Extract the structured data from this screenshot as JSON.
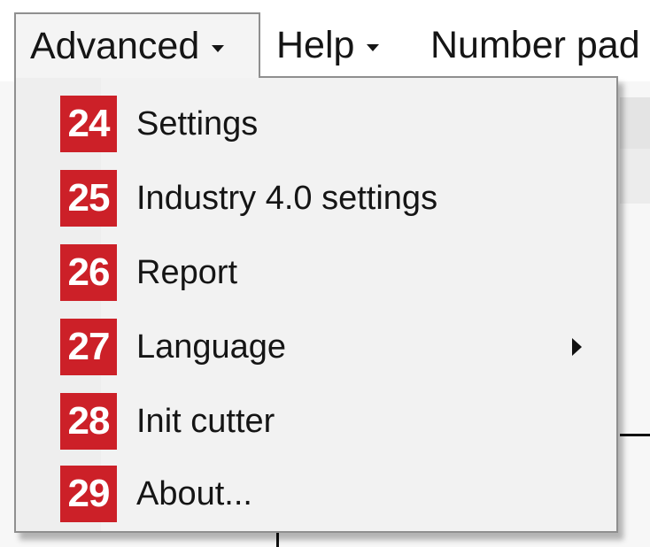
{
  "menubar": {
    "menus": [
      {
        "label": "Advanced",
        "icon": "chevron-down-icon"
      },
      {
        "label": "Help",
        "icon": "chevron-down-icon"
      },
      {
        "label": "Number pad",
        "icon": ""
      }
    ]
  },
  "dropdown": {
    "items": [
      {
        "badge": "24",
        "label": "Settings",
        "submenu": false
      },
      {
        "badge": "25",
        "label": "Industry 4.0 settings",
        "submenu": false
      },
      {
        "badge": "26",
        "label": "Report",
        "submenu": false
      },
      {
        "badge": "27",
        "label": "Language",
        "submenu": true
      },
      {
        "badge": "28",
        "label": "Init cutter",
        "submenu": false
      },
      {
        "badge": "29",
        "label": "About...",
        "submenu": false
      }
    ]
  },
  "colors": {
    "badge_bg": "#cc2028",
    "badge_text": "#ffffff",
    "menu_bg": "#f2f2f2",
    "menu_border": "#8f8f8f"
  }
}
